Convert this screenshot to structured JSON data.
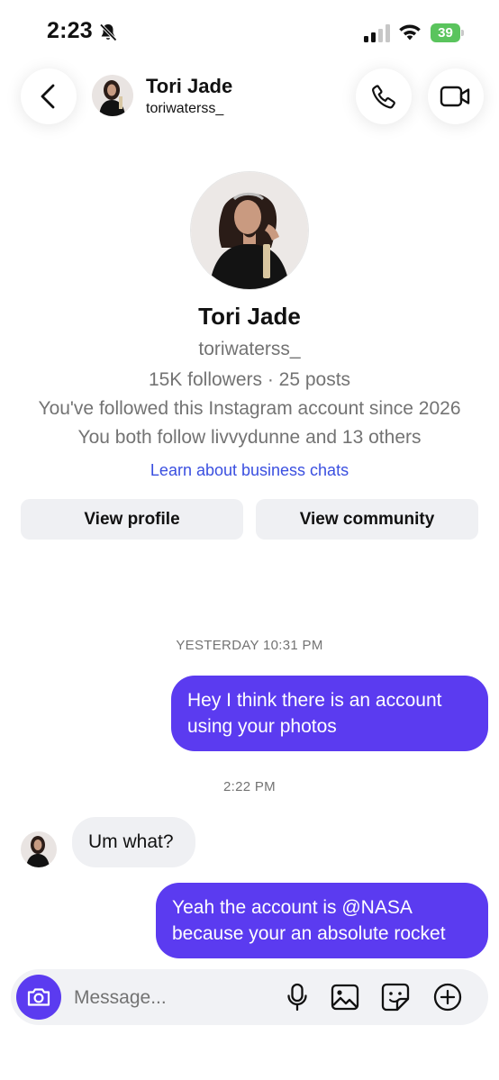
{
  "status_bar": {
    "time": "2:23",
    "battery": "39"
  },
  "header": {
    "name": "Tori Jade",
    "handle": "toriwaterss_"
  },
  "profile": {
    "name": "Tori Jade",
    "handle": "toriwaterss_",
    "stats": "15K followers · 25 posts",
    "followed_since": "You've followed this Instagram account since 2026",
    "mutual": "You both follow livvydunne and 13 others",
    "learn_link": "Learn about business chats",
    "view_profile": "View profile",
    "view_community": "View community"
  },
  "messages": [
    {
      "timestamp": "YESTERDAY 10:31 PM"
    },
    {
      "sender": "me",
      "text": "Hey I think there is an account using your photos"
    },
    {
      "timestamp": "2:22 PM"
    },
    {
      "sender": "them",
      "text": "Um what?"
    },
    {
      "sender": "me",
      "text": "Yeah the account is @NASA because your an absolute rocket"
    }
  ],
  "composer": {
    "placeholder": "Message..."
  },
  "colors": {
    "accent": "#5b3bf0",
    "link": "#3a4fe0",
    "battery": "#5ac45d"
  },
  "icons": [
    "bell-slash-icon",
    "signal-icon",
    "wifi-icon",
    "battery-icon",
    "back-chevron-icon",
    "phone-icon",
    "video-icon",
    "camera-icon",
    "microphone-icon",
    "gallery-icon",
    "sticker-icon",
    "plus-circle-icon"
  ]
}
